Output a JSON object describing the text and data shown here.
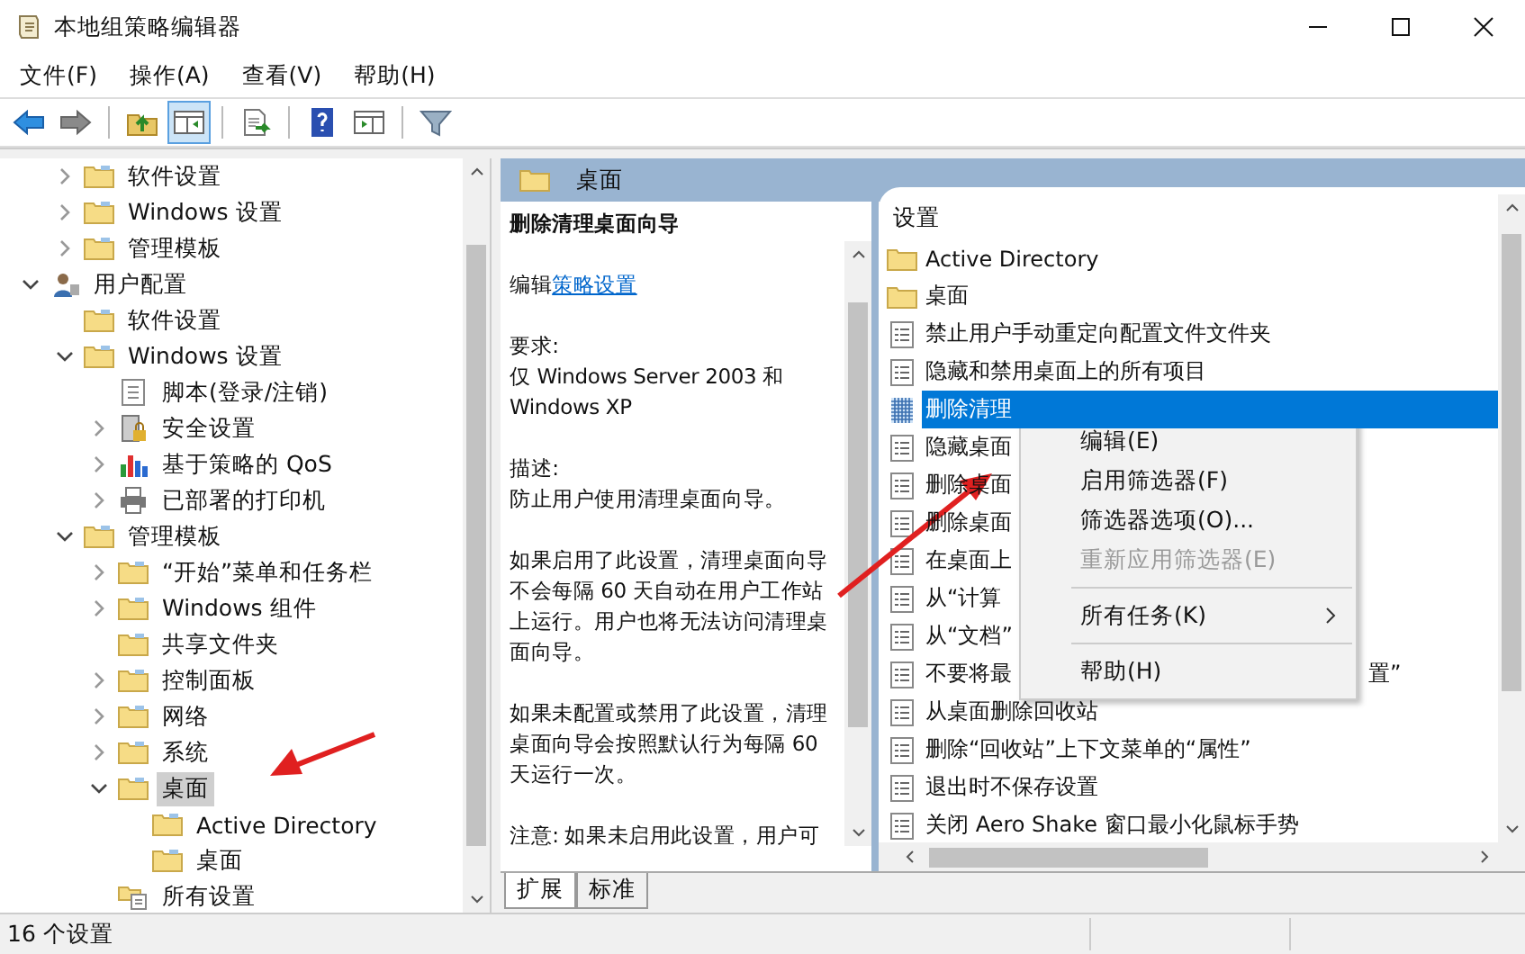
{
  "window": {
    "title": "本地组策略编辑器"
  },
  "menu": [
    "文件(F)",
    "操作(A)",
    "查看(V)",
    "帮助(H)"
  ],
  "toolbar": [
    [
      {
        "kind": "back",
        "pressed": false
      },
      {
        "kind": "forward",
        "pressed": false
      }
    ],
    [
      {
        "kind": "up",
        "pressed": false
      },
      {
        "kind": "tree",
        "pressed": true
      }
    ],
    [
      {
        "kind": "export",
        "pressed": false
      }
    ],
    [
      {
        "kind": "help",
        "pressed": false
      },
      {
        "kind": "action",
        "pressed": false
      }
    ],
    [
      {
        "kind": "filter",
        "pressed": false
      }
    ]
  ],
  "tree": {
    "items": [
      {
        "children": [
          {
            "label": "软件设置",
            "kind": "folder",
            "expanded": false,
            "selected": false
          },
          {
            "label": "Windows 设置",
            "kind": "folder",
            "expanded": false,
            "selected": false
          },
          {
            "label": "管理模板",
            "kind": "folder",
            "expanded": false,
            "selected": false
          }
        ]
      },
      {
        "label": "用户配置",
        "kind": "user",
        "expanded": true,
        "selected": false,
        "children": [
          {
            "label": "软件设置",
            "kind": "folder",
            "selected": false
          },
          {
            "label": "Windows 设置",
            "kind": "folder",
            "expanded": true,
            "selected": false,
            "children": [
              {
                "label": "脚本(登录/注销)",
                "kind": "script",
                "selected": false
              },
              {
                "label": "安全设置",
                "kind": "security",
                "expanded": false,
                "selected": false
              },
              {
                "label": "基于策略的 QoS",
                "kind": "qos",
                "expanded": false,
                "selected": false
              },
              {
                "label": "已部署的打印机",
                "kind": "printer",
                "expanded": false,
                "selected": false
              }
            ]
          },
          {
            "label": "管理模板",
            "kind": "folder",
            "expanded": true,
            "selected": false,
            "children": [
              {
                "label": "“开始”菜单和任务栏",
                "kind": "folder",
                "expanded": false,
                "selected": false
              },
              {
                "label": "Windows 组件",
                "kind": "folder",
                "expanded": false,
                "selected": false
              },
              {
                "label": "共享文件夹",
                "kind": "folder",
                "selected": false
              },
              {
                "label": "控制面板",
                "kind": "folder",
                "expanded": false,
                "selected": false
              },
              {
                "label": "网络",
                "kind": "folder",
                "expanded": false,
                "selected": false
              },
              {
                "label": "系统",
                "kind": "folder",
                "expanded": false,
                "selected": false
              },
              {
                "label": "桌面",
                "kind": "folder",
                "expanded": true,
                "selected": true,
                "children": [
                  {
                    "label": "Active Directory",
                    "kind": "folder",
                    "selected": false
                  },
                  {
                    "label": "桌面",
                    "kind": "folder",
                    "selected": false
                  }
                ]
              },
              {
                "label": "所有设置",
                "kind": "allsettings",
                "selected": false
              }
            ]
          }
        ]
      }
    ]
  },
  "header": {
    "title": "桌面"
  },
  "description": {
    "title": "删除清理桌面向导",
    "edit_prefix": "编辑",
    "edit_link": "策略设置",
    "paragraphs": [
      [
        "要求:",
        "仅 Windows Server 2003 和",
        "Windows XP"
      ],
      [
        "描述:",
        "防止用户使用清理桌面向导。"
      ],
      [
        "如果启用了此设置，清理桌面向导",
        "不会每隔 60 天自动在用户工作站",
        "上运行。用户也将无法访问清理桌",
        "面向导。"
      ],
      [
        "如果未配置或禁用了此设置，清理",
        "桌面向导会按照默认行为每隔 60",
        "天运行一次。"
      ],
      [
        "注意: 如果未启用此设置，用户可"
      ]
    ]
  },
  "tabs": [
    {
      "label": "扩展",
      "selected": true
    },
    {
      "label": "标准",
      "selected": false
    }
  ],
  "list": {
    "column": "设置",
    "rows": [
      {
        "kind": "folder",
        "text": "Active Directory",
        "selected": false
      },
      {
        "kind": "folder",
        "text": "桌面",
        "selected": false
      },
      {
        "kind": "policy",
        "text": "禁止用户手动重定向配置文件文件夹",
        "selected": false
      },
      {
        "kind": "policy",
        "text": "隐藏和禁用桌面上的所有项目",
        "selected": false
      },
      {
        "kind": "policy",
        "text": "删除清理",
        "selected": true
      },
      {
        "kind": "policy",
        "text": "隐藏桌面",
        "selected": false
      },
      {
        "kind": "policy",
        "text": "删除桌面",
        "selected": false
      },
      {
        "kind": "policy",
        "text": "删除桌面",
        "selected": false
      },
      {
        "kind": "policy",
        "text": "在桌面上",
        "selected": false
      },
      {
        "kind": "policy",
        "text": "从“计算",
        "selected": false
      },
      {
        "kind": "policy",
        "text": "从“文档”",
        "selected": false
      },
      {
        "kind": "policy",
        "text": "不要将最",
        "tail": "置”",
        "selected": false
      },
      {
        "kind": "policy",
        "text": "从桌面删除回收站",
        "selected": false
      },
      {
        "kind": "policy",
        "text": "删除“回收站”上下文菜单的“属性”",
        "selected": false
      },
      {
        "kind": "policy",
        "text": "退出时不保存设置",
        "selected": false
      },
      {
        "kind": "policy",
        "text": "关闭 Aero Shake 窗口最小化鼠标手势",
        "selected": false
      }
    ]
  },
  "context_menu": [
    {
      "kind": "item",
      "label": "编辑(E)",
      "disabled": false
    },
    {
      "kind": "item",
      "label": "启用筛选器(F)",
      "disabled": false
    },
    {
      "kind": "item",
      "label": "筛选器选项(O)...",
      "disabled": false
    },
    {
      "kind": "item",
      "label": "重新应用筛选器(E)",
      "disabled": true
    },
    {
      "kind": "separator"
    },
    {
      "kind": "submenu",
      "label": "所有任务(K)",
      "disabled": false
    },
    {
      "kind": "separator"
    },
    {
      "kind": "item",
      "label": "帮助(H)",
      "disabled": false
    }
  ],
  "status_bar": {
    "text": "16 个设置"
  }
}
